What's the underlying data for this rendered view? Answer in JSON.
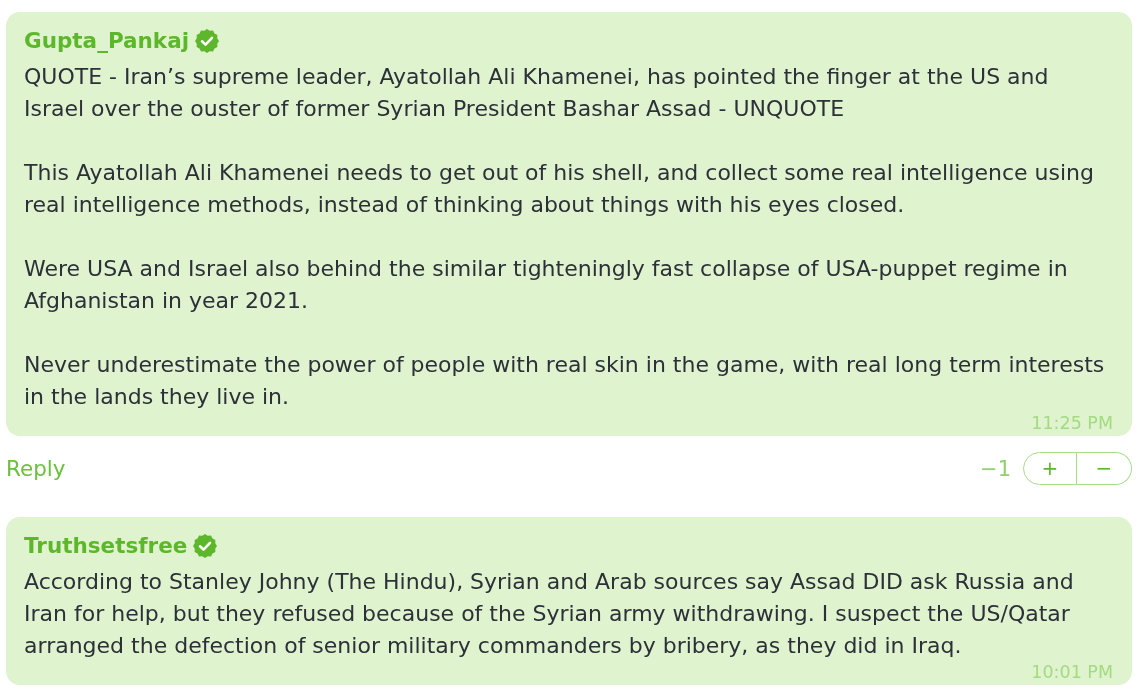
{
  "comments": [
    {
      "author": "Gupta_Pankaj",
      "verified": true,
      "paragraphs": [
        "QUOTE - Iran’s supreme leader, Ayatollah Ali Khamenei, has pointed the finger at the US and Israel over the ouster of former Syrian President Bashar Assad - UNQUOTE",
        "This Ayatollah Ali Khamenei needs to get out of his shell, and collect some real intelligence using real intelligence methods, instead of thinking about things with his eyes closed.",
        "Were USA and Israel also behind the similar tighteningly fast collapse of USA-puppet regime in Afghanistan in year 2021.",
        "Never underestimate the power of people with real skin in the game, with real long term interests in the lands they live in."
      ],
      "time": "11:25 PM",
      "reply": "Reply",
      "score": "−1",
      "vote_up": "+",
      "vote_down": "−"
    },
    {
      "author": "Truthsetsfree",
      "verified": true,
      "paragraphs": [
        "According to Stanley Johny (The Hindu), Syrian and Arab sources say Assad DID ask Russia and Iran for help, but they refused because of the Syrian army withdrawing. I suspect the US/Qatar arranged the defection of senior military commanders by bribery, as they did in Iraq."
      ],
      "time": "10:01 PM"
    }
  ]
}
